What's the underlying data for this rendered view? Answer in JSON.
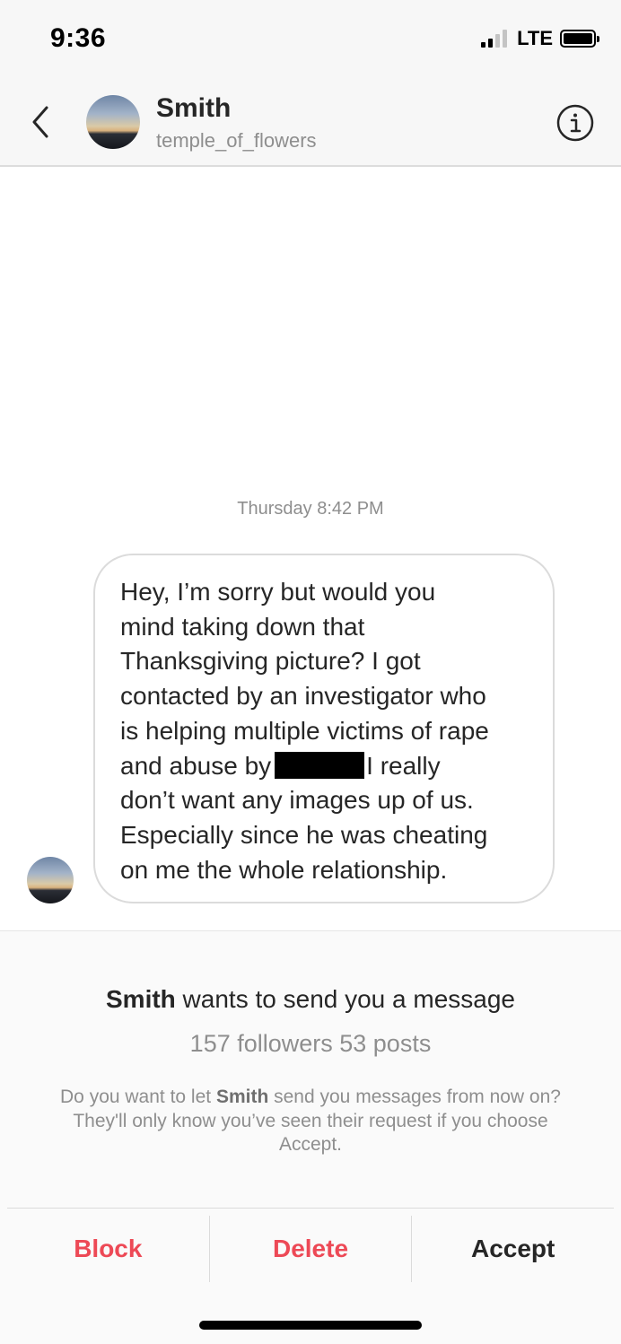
{
  "status_bar": {
    "time": "9:36",
    "network": "LTE",
    "signal_bars_active": 2,
    "signal_bars_total": 4,
    "battery_icon": "battery-full-icon"
  },
  "header": {
    "back_icon": "chevron-left-icon",
    "name": "Smith",
    "username": "temple_of_flowers",
    "info_icon": "info-circle-icon"
  },
  "conversation": {
    "timestamp": "Thursday 8:42 PM",
    "message_lines": {
      "l1": "Hey, I’m sorry but would you",
      "l2": "mind taking down that",
      "l3": "Thanksgiving picture? I got",
      "l4": "contacted by an investigator who",
      "l5": "is helping multiple victims of rape",
      "l6_before": "and abuse by",
      "l6_after": "I really",
      "l7": "don’t want any images up of us.",
      "l8": "Especially since he was cheating",
      "l9": "on me the whole relationship."
    }
  },
  "request": {
    "title_name": "Smith",
    "title_rest": " wants to send you a message",
    "stats": "157 followers 53 posts",
    "desc_before": "Do you want to let ",
    "desc_name": "Smith",
    "desc_after": " send you messages from now on? They'll only know you’ve seen their request if you choose Accept."
  },
  "actions": {
    "block_label": "Block",
    "delete_label": "Delete",
    "accept_label": "Accept"
  },
  "colors": {
    "destructive": "#ed4956",
    "primary_text": "#262626",
    "secondary_text": "#8e8e8e"
  }
}
